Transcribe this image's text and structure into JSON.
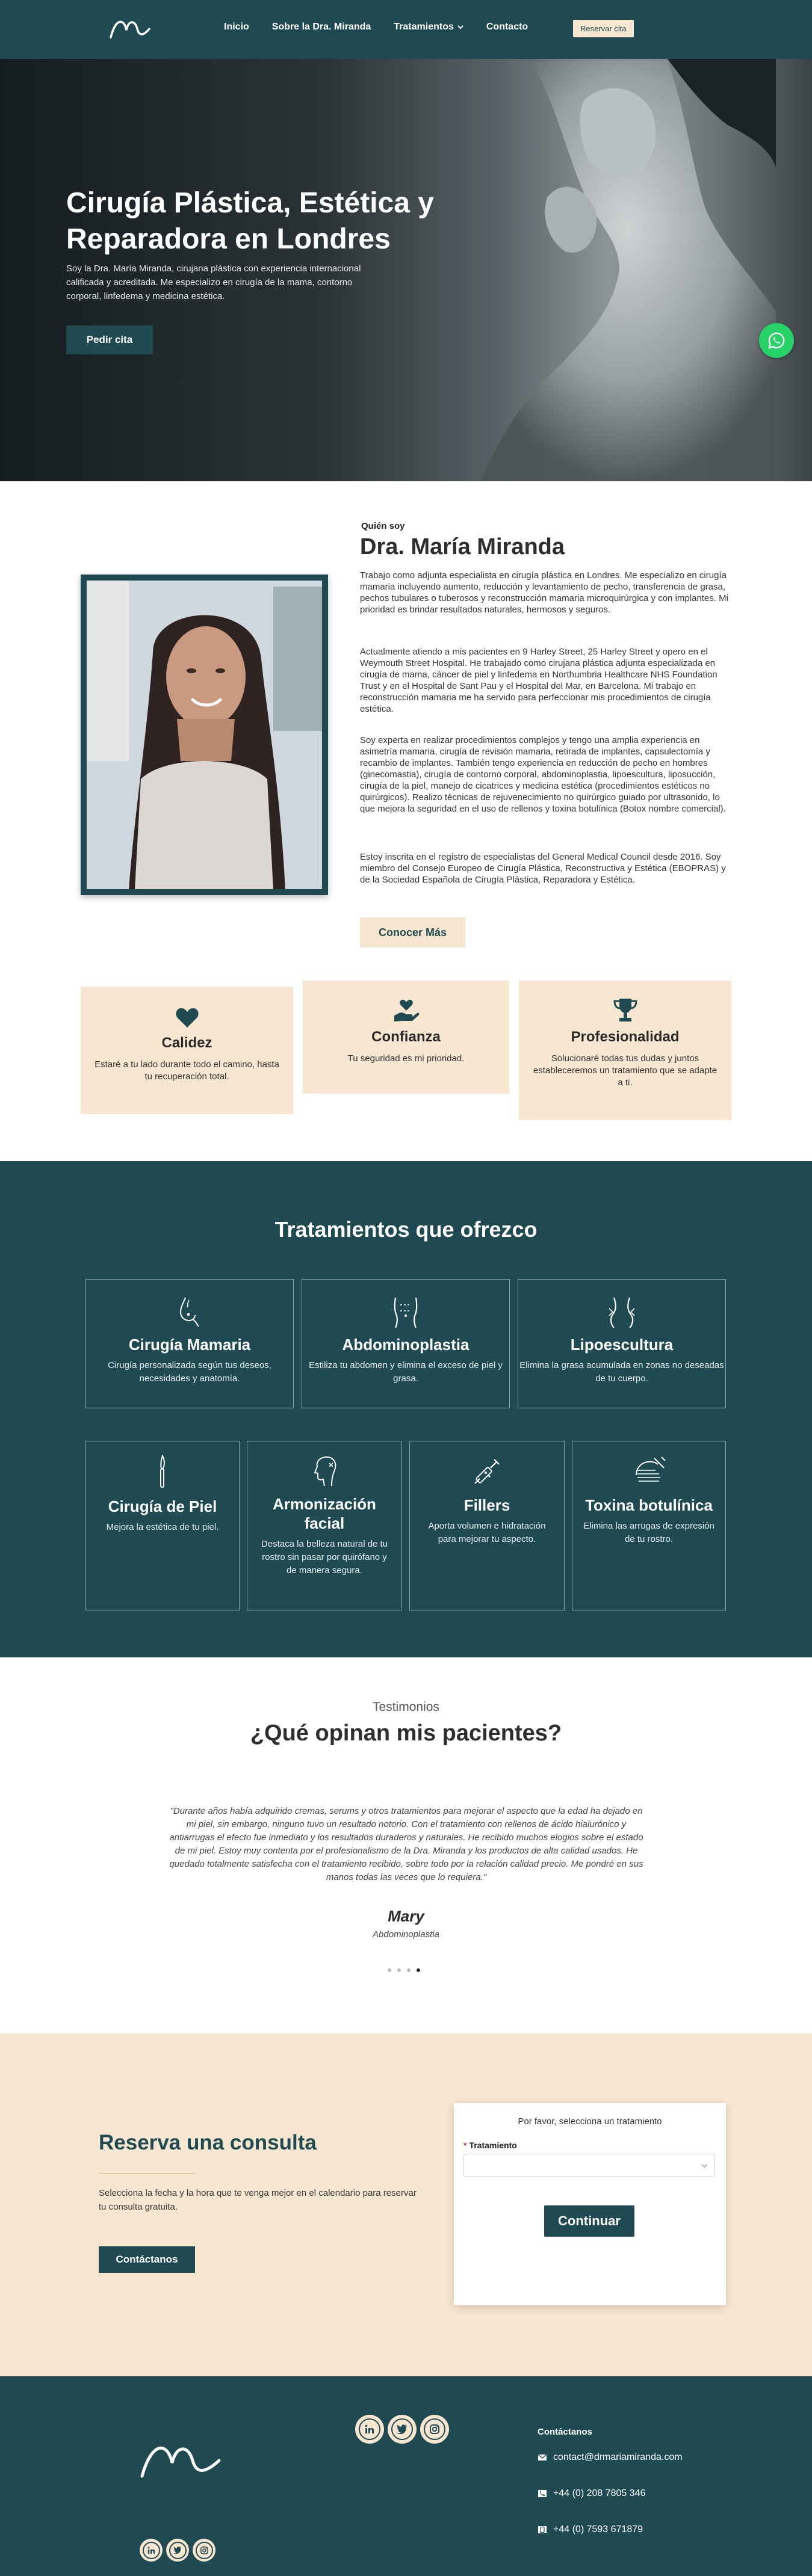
{
  "header": {
    "nav": [
      {
        "label": "Inicio"
      },
      {
        "label": "Sobre la Dra. Miranda"
      },
      {
        "label": "Tratamientos"
      },
      {
        "label": "Contacto"
      }
    ],
    "cta": "Reservar cita"
  },
  "hero": {
    "title": "Cirugía Plástica, Estética y Reparadora en Londres",
    "text": "Soy la Dra. María Miranda, cirujana plástica con experiencia internacional calificada y acreditada. Me especializo en cirugía de la mama, contorno corporal, linfedema y medicina estética.",
    "button": "Pedir cita"
  },
  "about": {
    "kicker": "Quién soy",
    "name": "Dra. María Miranda",
    "paragraphs": [
      "Trabajo como adjunta especialista en cirugía plástica en Londres. Me especializo en cirugía mamaria incluyendo aumento, reducción y levantamiento de pecho, transferencia de grasa, pechos tubulares o tuberosos y reconstrucción mamaria microquirúrgica y con implantes. Mi prioridad es brindar resultados naturales, hermosos y seguros.",
      "Actualmente atiendo a mis pacientes en 9 Harley Street, 25 Harley Street y opero en el Weymouth Street Hospital. He trabajado como cirujana plástica adjunta especializada en cirugía de mama, cáncer de piel y linfedema en Northumbria Healthcare NHS Foundation Trust y en el Hospital de Sant Pau y el Hospital del Mar, en Barcelona. Mi trabajo en reconstrucción mamaria me ha servido para perfeccionar mis procedimientos de cirugía estética.",
      "Soy experta en realizar procedimientos complejos y tengo una amplia experiencia en asimetría mamaria, cirugía de revisión mamaria, retirada de implantes, capsulectomía y recambio de implantes. También tengo experiencia en reducción de pecho en hombres (ginecomastia), cirugía de contorno corporal, abdominoplastia, lipoescultura, liposucción, cirugía de la piel, manejo de cicatrices y medicina estética (procedimientos estéticos no quirúrgicos). Realizo técnicas de rejuvenecimiento no quirúrgico guiado por ultrasonido, lo que mejora la seguridad en el uso de rellenos y toxina botulínica (Botox nombre comercial).",
      "Estoy inscrita en el registro de especialistas del General Medical Council desde 2016. Soy miembro del Consejo Europeo de Cirugía Plástica, Reconstructiva y Estética (EBOPRAS) y de la Sociedad Española de Cirugía Plástica, Reparadora y Estética."
    ],
    "button": "Conocer Más"
  },
  "values": [
    {
      "title": "Calidez",
      "text": "Estaré a tu lado durante todo el camino, hasta tu recuperación total.",
      "icon": "heart-icon"
    },
    {
      "title": "Confianza",
      "text": "Tu seguridad es mi prioridad.",
      "icon": "hand-heart-icon"
    },
    {
      "title": "Profesionalidad",
      "text": "Solucionaré todas tus dudas y juntos estableceremos un tratamiento que se adapte a ti.",
      "icon": "trophy-icon"
    }
  ],
  "treatments": {
    "title": "Tratamientos que ofrezco",
    "items": [
      {
        "title": "Cirugía Mamaria",
        "text": "Cirugía personalizada según tus deseos, necesidades y anatomía.",
        "icon": "breast-icon"
      },
      {
        "title": "Abdominoplastia",
        "text": "Estiliza tu abdomen y elimina el exceso de piel y grasa.",
        "icon": "abdomen-icon"
      },
      {
        "title": "Lipoescultura",
        "text": "Elimina la grasa acumulada en zonas no deseadas de tu cuerpo.",
        "icon": "waist-icon"
      },
      {
        "title": "Cirugía de Piel",
        "text": "Mejora la estética de tu piel.",
        "icon": "scalpel-icon"
      },
      {
        "title": "Armonización facial",
        "text": "Destaca la belleza natural de tu rostro sin pasar por quirófano y de manera segura.",
        "icon": "face-icon"
      },
      {
        "title": "Fillers",
        "text": "Aporta volumen e hidratación para mejorar tu aspecto.",
        "icon": "syringe-icon"
      },
      {
        "title": "Toxina botulínica",
        "text": "Elimina las arrugas de expresión de tu rostro.",
        "icon": "face-lines-icon"
      }
    ]
  },
  "testimonials": {
    "kicker": "Testimonios",
    "title": "¿Qué opinan mis pacientes?",
    "quote": "\"Durante años había adquirido cremas, serums y otros tratamientos para mejorar el aspecto que la edad ha dejado en mi piel, sin embargo, ninguno tuvo un resultado notorio. Con el tratamiento con rellenos de ácido hialurónico y antiarrugas el efecto fue inmediato y los resultados duraderos y naturales. He recibido muchos elogios sobre el estado de mi piel. Estoy muy contenta por el profesionalismo de la Dra. Miranda y los productos de alta calidad usados. He quedado totalmente satisfecha con el tratamiento recibido, sobre todo por la relación calidad precio. Me pondré en sus manos todas las veces que lo requiera.\"",
    "name": "Mary",
    "treatment": "Abdominoplastia",
    "active_dot": 4,
    "dot_count": 4
  },
  "booking": {
    "title": "Reserva una consulta",
    "text": "Selecciona la fecha y la hora que te venga mejor en el calendario para reservar tu consulta gratuita.",
    "button": "Contáctanos",
    "form": {
      "note": "Por favor, selecciona un tratamiento",
      "label": "Tratamiento",
      "required_mark": "*",
      "select_value": "",
      "submit": "Continuar"
    }
  },
  "footer": {
    "contact_title": "Contáctanos",
    "email": "contact@drmariamiranda.com",
    "phone1": "+44 (0) 208 7805 346",
    "phone2": "+44 (0) 7593 671879",
    "social": [
      "linkedin-icon",
      "twitter-icon",
      "instagram-icon"
    ]
  },
  "colors": {
    "primary": "#1f4a52",
    "cream": "#f8e7d0",
    "whatsapp": "#25d366"
  }
}
